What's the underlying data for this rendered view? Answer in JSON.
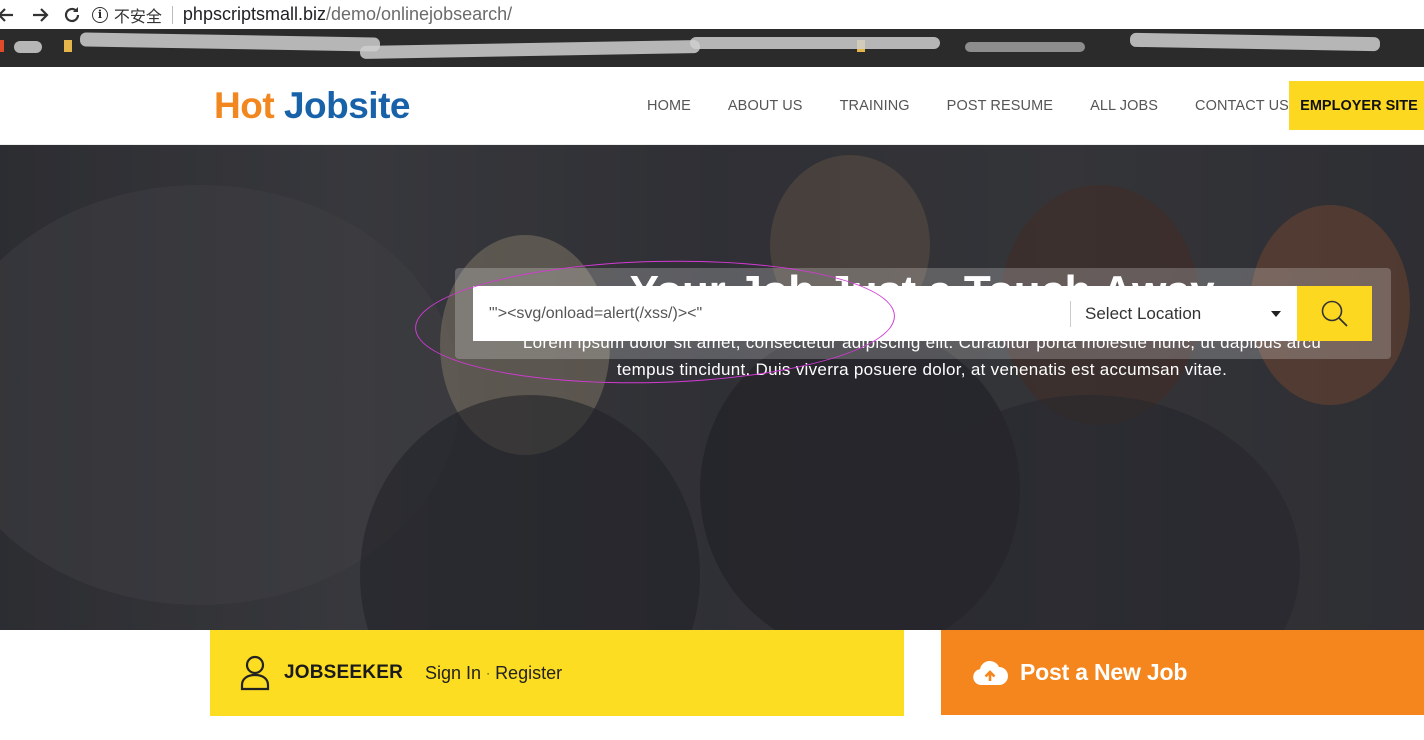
{
  "browser": {
    "security_label": "不安全",
    "url_host": "phpscriptsmall.biz",
    "url_path": "/demo/onlinejobsearch/"
  },
  "header": {
    "logo_hot": "Hot",
    "logo_jobsite": "Jobsite",
    "nav": [
      "HOME",
      "ABOUT US",
      "TRAINING",
      "POST RESUME",
      "ALL JOBS",
      "CONTACT US"
    ],
    "employer_button": "EMPLOYER SITE"
  },
  "hero": {
    "title": "Your Job Just a Touch Away",
    "subtitle": "Lorem ipsum dolor sit amet, consectetur adipiscing elit. Curabitur porta molestie nunc, ut dapibus arcu tempus tincidunt. Duis viverra posuere dolor, at venenatis est accumsan vitae.",
    "search": {
      "value": "\"'><svg/onload=alert(/xss/)><\"",
      "location_selected": "Select Location"
    }
  },
  "jobseeker": {
    "title": "JOBSEEKER",
    "sign_in": "Sign In",
    "separator": "·",
    "register": "Register"
  },
  "post_job": {
    "label": "Post a New Job"
  },
  "icons": {
    "back": "arrow-left-icon",
    "forward": "arrow-right-icon",
    "reload": "reload-icon",
    "info": "info-icon",
    "search": "search-icon",
    "user": "user-icon",
    "upload": "cloud-upload-icon"
  },
  "colors": {
    "accent_yellow": "#fcd820",
    "accent_orange": "#f5861e",
    "logo_orange": "#f2861f",
    "logo_blue": "#1762a8",
    "annotation": "#d23ad4"
  }
}
